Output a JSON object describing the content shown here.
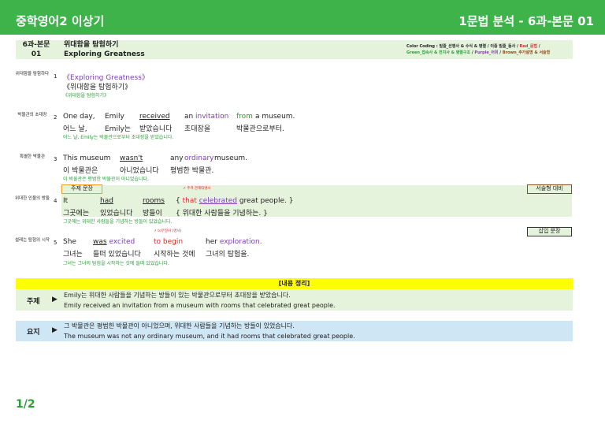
{
  "header": {
    "left_title": "중학영어2 이상기",
    "right_title": "1문법 분석 - 6과-본문 01"
  },
  "lesson": {
    "code_line1": "6과-본문",
    "code_line2": "01",
    "title_ko": "위대함을 탐험하기",
    "title_en": "Exploring Greatness"
  },
  "legend": {
    "line1_prefix": "Color Coding : 밑줄_선행사 & 수식 & 병렬 / 이중 밑줄_동사 / ",
    "line1_red": "Red_문법",
    "line1_suffix": " /",
    "line2_green": "Green_접속사 & 전치사 & 병렬구조",
    "line2_sep1": " / ",
    "line2_purple": "Purple_어휘",
    "line2_sep2": " / ",
    "line2_brown": "Brown_추가설명 & 서술형"
  },
  "sentences": [
    {
      "side": "위대함을 탐험하다",
      "num": "1",
      "en": "《Exploring Greatness》",
      "ko": "《위대함을 탐험하기》",
      "tr": "《위대함을 탐험하기》"
    },
    {
      "side": "박물관의 초대장",
      "num": "2",
      "en_w1": "One day,",
      "en_w2": "Emily",
      "en_w3": "received",
      "en_w4": "an",
      "en_w5": "invitation",
      "en_w6": "from",
      "en_w7": "a museum.",
      "ko_w1": "어느 날,",
      "ko_w2": "Emily는",
      "ko_w3": "받았습니다",
      "ko_w4": "초대장을",
      "ko_w5": "박물관으로부터.",
      "tr": "어느 날, Emily는 박물관으로부터 초대장을 받았습니다."
    },
    {
      "side": "특별한 박물관",
      "num": "3",
      "en_w1": "This museum",
      "en_w2": "wasn't",
      "en_w3": "any",
      "en_w4": "ordinary",
      "en_w5": "museum.",
      "ko_w1": "이 박물관은",
      "ko_w2": "아니었습니다",
      "ko_w3": "평범한 박물관.",
      "tr": "이 박물관은 평범한 박물관이 아니었습니다."
    },
    {
      "side": "위대한 인물의 방들",
      "num": "4",
      "en_w1": "It",
      "en_w2": "had",
      "en_w3": "rooms",
      "en_w4a": "{ ",
      "en_w4b": "that",
      "en_w4c": " ",
      "en_w4d": "celebrated",
      "en_w4e": " great people. }",
      "ko_w1": "그곳에는",
      "ko_w2": "있었습니다",
      "ko_w3": "방들이",
      "ko_w4": "{ 위대한 사람들을 기념하는. }",
      "tr": "그곳에는 위대한 사람들을 기념하는 방들이 있었습니다.",
      "box_left": "주제 문장",
      "box_right": "서술형 대비",
      "ann": "주격 관계대명사"
    },
    {
      "side": "설레는 탐험의 시작",
      "num": "5",
      "en_w1": "She",
      "en_w2a": "was",
      "en_w2b": "excited",
      "en_w3": "to begin",
      "en_w4a": "her",
      "en_w4b": "exploration.",
      "ko_w1": "그녀는",
      "ko_w2": "들떠 있었습니다",
      "ko_w3": "시작하는 것에",
      "ko_w4": "그녀의 탐험을.",
      "tr": "그녀는 그녀의 탐험을 시작하는 것에 들떠 있었습니다.",
      "box_right": "삽입 문장",
      "ann": "to부정사 (명사)"
    }
  ],
  "summary": {
    "title": "[내용 정리]",
    "theme_label": "주제",
    "theme_ko": "Emily는 위대한 사람들을 기념하는 방들이 있는 박물관으로부터 초대장을 받았습니다.",
    "theme_en": "Emily received an invitation from a museum with rooms that celebrated great people.",
    "gist_label": "요지",
    "gist_ko": "그 박물관은 평범한 박물관이 아니었으며, 위대한 사람들을 기념하는 방들이 있었습니다.",
    "gist_en": "The museum was not any ordinary museum, and it had rooms that celebrated great people.",
    "arrow": "▶"
  },
  "page": "1/2",
  "colors": {
    "green_bar": "#3db349",
    "light_green": "#e6f3dc",
    "light_blue": "#cfe6f5",
    "yellow": "#ffff00"
  }
}
